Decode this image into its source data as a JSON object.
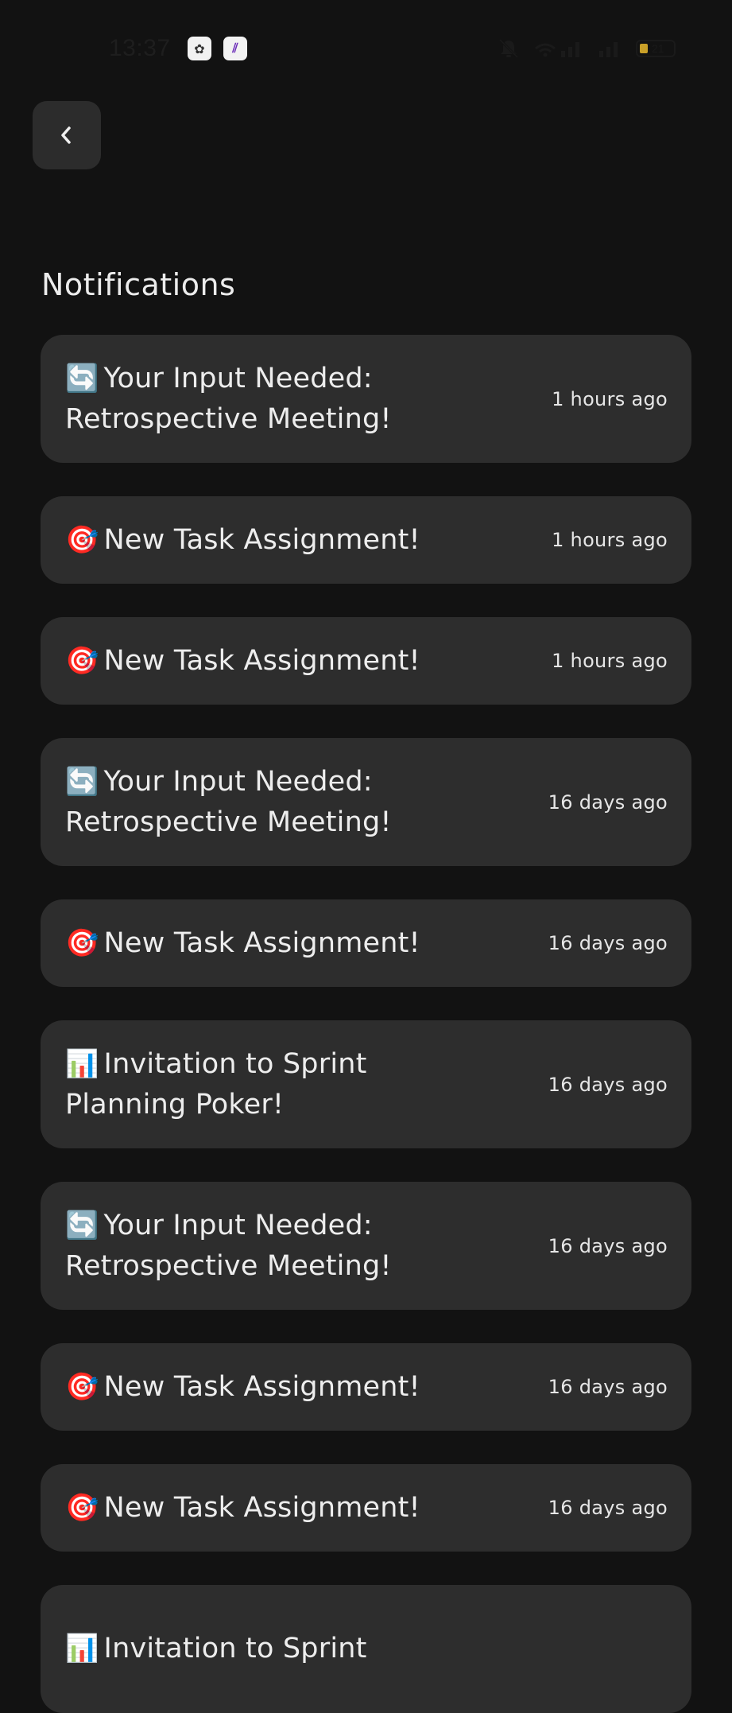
{
  "status_bar": {
    "time": "13:37",
    "battery_level": "21",
    "battery_fraction": 0.21,
    "battery_color": "#c9a028"
  },
  "header": {
    "back_icon": "chevron-left-icon",
    "title": "Notifications"
  },
  "notifications": [
    {
      "icon": "repeat-arrows-emoji",
      "emoji": "🔄",
      "title": "Your Input Needed: Retrospective Meeting!",
      "time": "1 hours ago"
    },
    {
      "icon": "target-emoji",
      "emoji": "🎯",
      "title": "New Task Assignment!",
      "time": "1 hours ago"
    },
    {
      "icon": "target-emoji",
      "emoji": "🎯",
      "title": "New Task Assignment!",
      "time": "1 hours ago"
    },
    {
      "icon": "repeat-arrows-emoji",
      "emoji": "🔄",
      "title": "Your Input Needed: Retrospective Meeting!",
      "time": "16 days ago"
    },
    {
      "icon": "target-emoji",
      "emoji": "🎯",
      "title": "New Task Assignment!",
      "time": "16 days ago"
    },
    {
      "icon": "bar-chart-emoji",
      "emoji": "📊",
      "title": "Invitation to Sprint Planning Poker!",
      "time": "16 days ago"
    },
    {
      "icon": "repeat-arrows-emoji",
      "emoji": "🔄",
      "title": "Your Input Needed: Retrospective Meeting!",
      "time": "16 days ago"
    },
    {
      "icon": "target-emoji",
      "emoji": "🎯",
      "title": "New Task Assignment!",
      "time": "16 days ago"
    },
    {
      "icon": "target-emoji",
      "emoji": "🎯",
      "title": "New Task Assignment!",
      "time": "16 days ago"
    },
    {
      "icon": "bar-chart-emoji",
      "emoji": "📊",
      "title": "Invitation to Sprint",
      "time": ""
    }
  ],
  "colors": {
    "background": "#121212",
    "card": "#2d2d2d",
    "button": "#2c2c2c",
    "text": "#ededed"
  }
}
